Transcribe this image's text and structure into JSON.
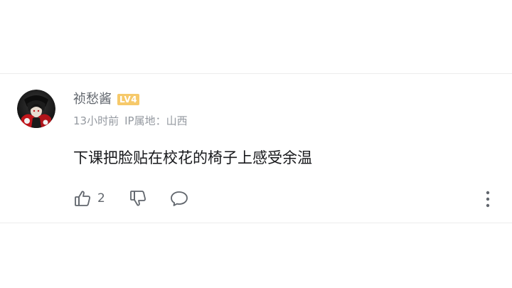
{
  "comment": {
    "username": "祯愁酱",
    "level_badge": "LV4",
    "time": "13小时前",
    "ip_location": "IP属地：山西",
    "content": "下课把脸贴在校花的椅子上感受余温",
    "like_count": "2",
    "colors": {
      "username": "#61666d",
      "meta": "#9499a0",
      "content": "#18191c",
      "level_badge": "#f6c96a",
      "icon": "#61666d"
    },
    "icons": {
      "like": "thumbs-up-icon",
      "dislike": "thumbs-down-icon",
      "reply": "speech-bubble-icon",
      "more": "vertical-ellipsis-icon"
    }
  }
}
